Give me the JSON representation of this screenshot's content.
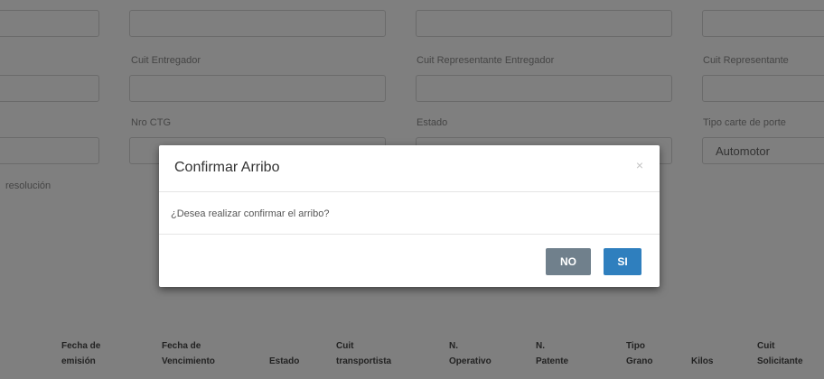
{
  "form": {
    "labels": {
      "cuit_entregador": "Cuit Entregador",
      "cuit_representante_entregador": "Cuit Representante Entregador",
      "cuit_representante": "Cuit Representante",
      "nro_ctg": "Nro CTG",
      "estado": "Estado",
      "tipo_carta_de_porte": "Tipo carte de porte",
      "resolucion": "resolución"
    },
    "tipo_carta_value": "Automotor"
  },
  "table": {
    "headers": [
      [
        "Fecha de",
        "emisión"
      ],
      [
        "Fecha de",
        "Vencimiento"
      ],
      [
        "",
        "Estado"
      ],
      [
        "Cuit",
        "transportista"
      ],
      [
        "N.",
        "Operativo"
      ],
      [
        "N.",
        "Patente"
      ],
      [
        "Tipo",
        "Grano"
      ],
      [
        "",
        "Kilos"
      ],
      [
        "Cuit",
        "Solicitante"
      ]
    ]
  },
  "modal": {
    "title": "Confirmar Arribo",
    "close_symbol": "×",
    "message": "¿Desea realizar confirmar el arribo?",
    "no_label": "NO",
    "si_label": "SI"
  },
  "colors": {
    "btn_no": "#70808c",
    "btn_si": "#2f7fbe",
    "backdrop": "rgba(0,0,0,0.5)"
  }
}
